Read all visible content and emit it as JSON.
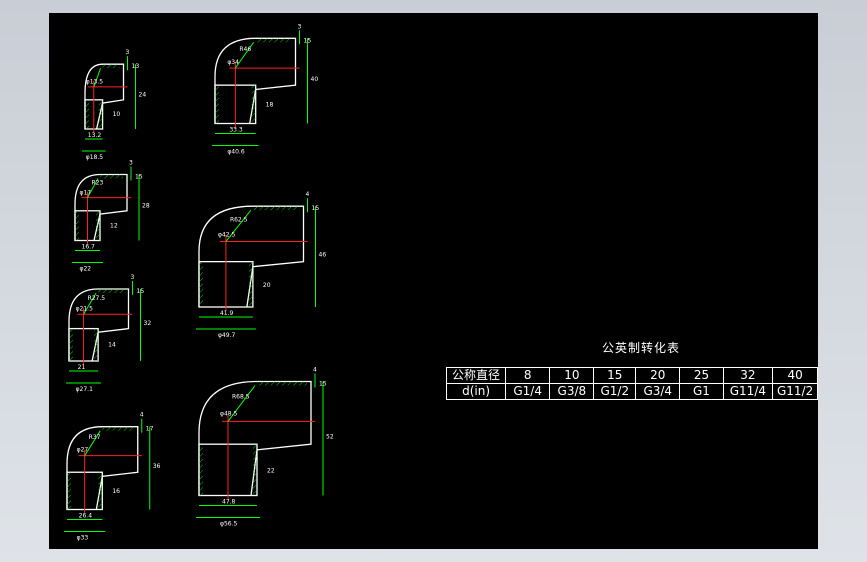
{
  "table": {
    "title": "公英制转化表",
    "rows": [
      [
        "公称直径",
        "8",
        "10",
        "15",
        "20",
        "25",
        "32",
        "40"
      ],
      [
        "d(in)",
        "G1/4",
        "G3/8",
        "G1/2",
        "G3/4",
        "G1",
        "G11/4",
        "G11/2"
      ]
    ]
  },
  "fittings": [
    {
      "id": "e1",
      "dims": [
        "φ13.5",
        "13.2",
        "φ18.5",
        "24",
        "3",
        "13",
        "10"
      ]
    },
    {
      "id": "e2",
      "dims": [
        "φ17",
        "16.7",
        "φ22",
        "28",
        "3",
        "15",
        "12",
        "R23"
      ]
    },
    {
      "id": "e3",
      "dims": [
        "φ21.5",
        "21",
        "φ27.1",
        "32",
        "3",
        "15",
        "14",
        "R27.5"
      ]
    },
    {
      "id": "e4",
      "dims": [
        "φ27",
        "26.4",
        "φ33",
        "36",
        "4",
        "17",
        "16",
        "R37"
      ]
    },
    {
      "id": "e5",
      "dims": [
        "φ34",
        "33.3",
        "φ40.6",
        "40",
        "3",
        "15",
        "18",
        "R46"
      ]
    },
    {
      "id": "e6",
      "dims": [
        "φ42.5",
        "41.9",
        "φ49.7",
        "46",
        "4",
        "15",
        "20",
        "R62.5"
      ]
    },
    {
      "id": "e7",
      "dims": [
        "φ48.5",
        "47.8",
        "φ56.5",
        "52",
        "4",
        "15",
        "22",
        "R68.5"
      ]
    }
  ],
  "colors": {
    "background": "#000000",
    "lines": "#00ff00",
    "outline": "#ffffff",
    "center": "#ff2020"
  }
}
